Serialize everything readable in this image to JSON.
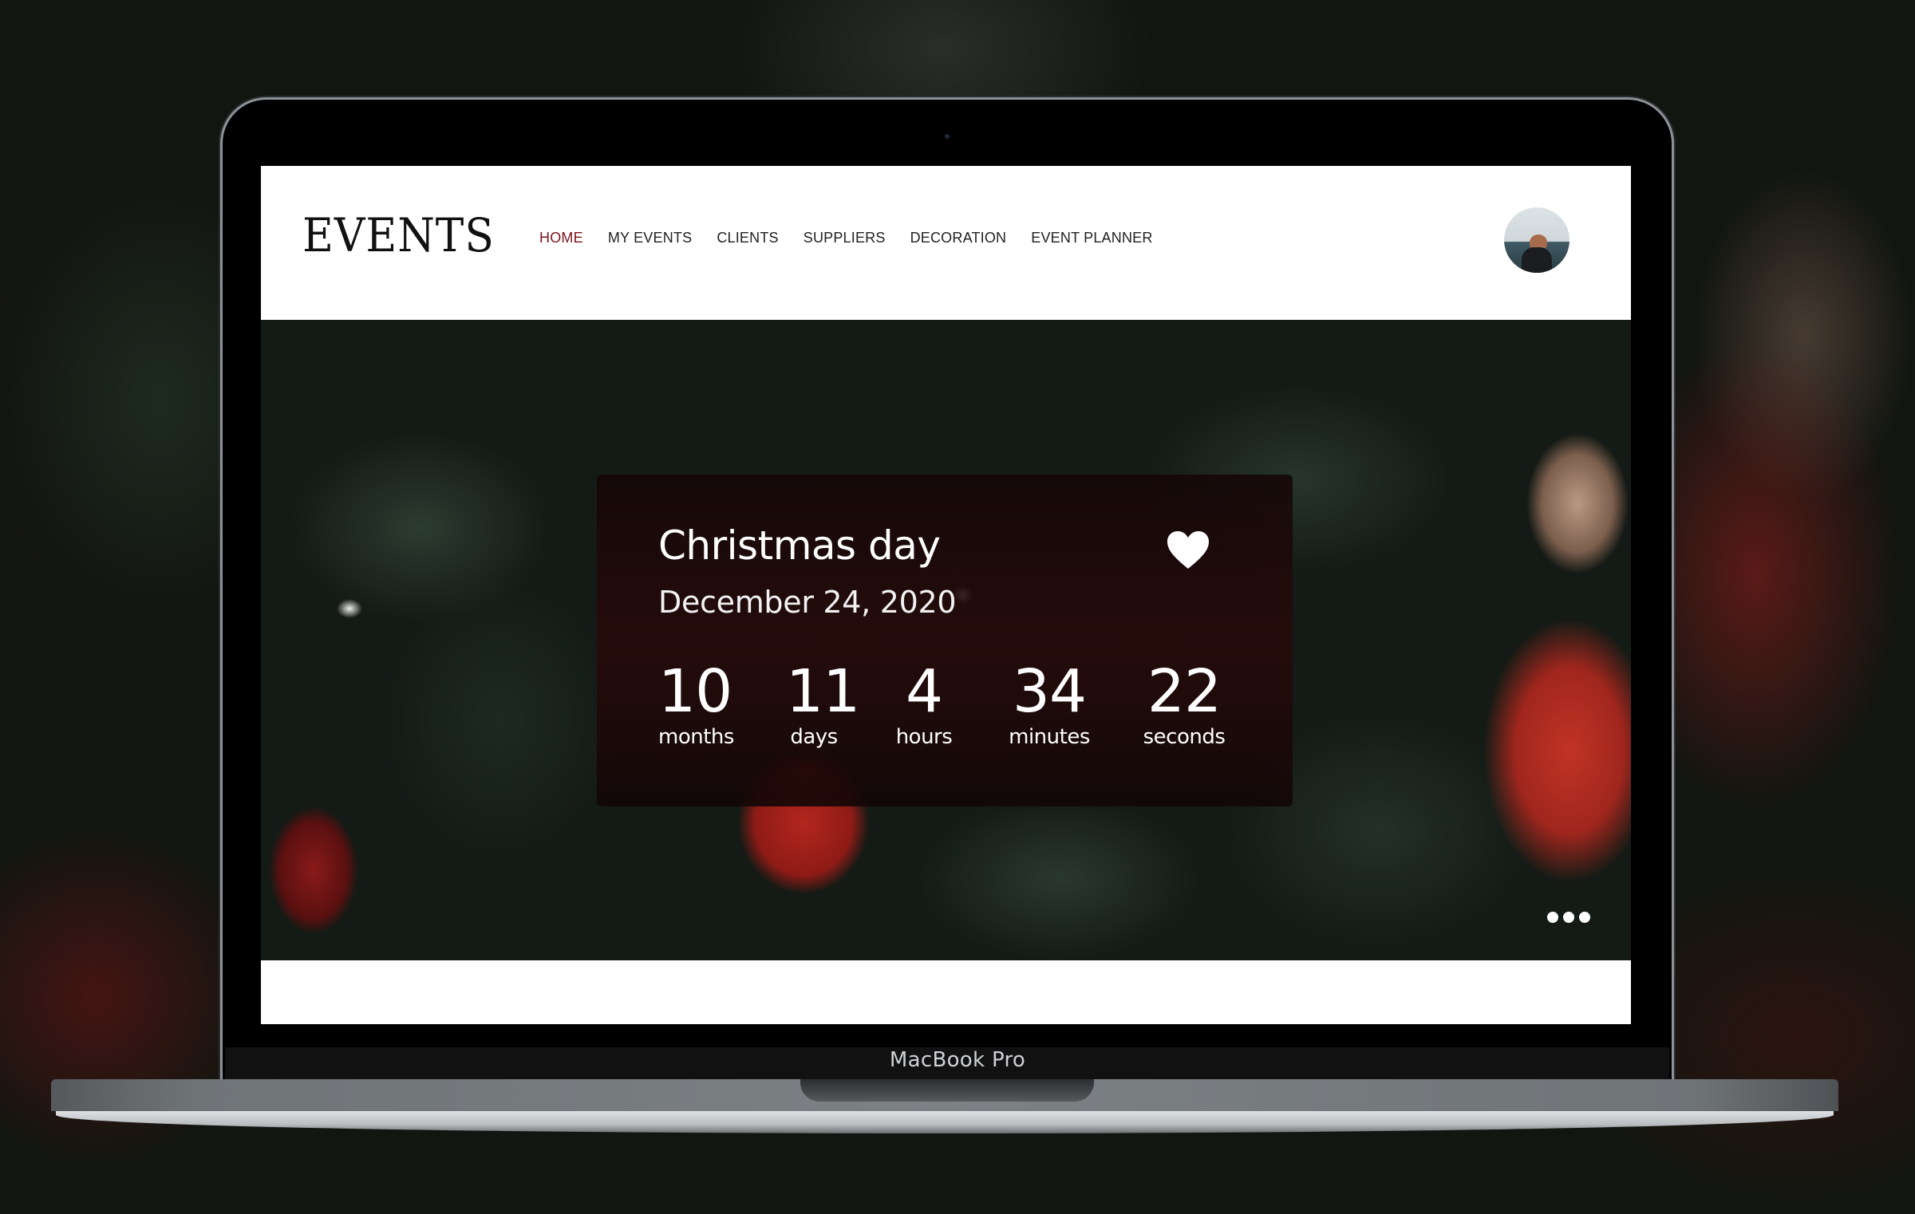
{
  "device": {
    "brand_label": "MacBook Pro"
  },
  "navbar": {
    "logo": "EVENTS",
    "links": [
      {
        "label": "HOME",
        "active": true
      },
      {
        "label": "MY EVENTS",
        "active": false
      },
      {
        "label": "CLIENTS",
        "active": false
      },
      {
        "label": "SUPPLIERS",
        "active": false
      },
      {
        "label": "DECORATION",
        "active": false
      },
      {
        "label": "EVENT PLANNER",
        "active": false
      }
    ],
    "active_color": "#7d1419",
    "avatar_icon": "user-avatar"
  },
  "hero": {
    "event": {
      "title": "Christmas day",
      "date": "December 24, 2020",
      "favorite_icon": "heart-icon",
      "countdown": [
        {
          "value": "10",
          "unit": "months"
        },
        {
          "value": "11",
          "unit": "days"
        },
        {
          "value": "4",
          "unit": "hours"
        },
        {
          "value": "34",
          "unit": "minutes"
        },
        {
          "value": "22",
          "unit": "seconds"
        }
      ]
    },
    "more_icon": "more-dots-icon"
  }
}
